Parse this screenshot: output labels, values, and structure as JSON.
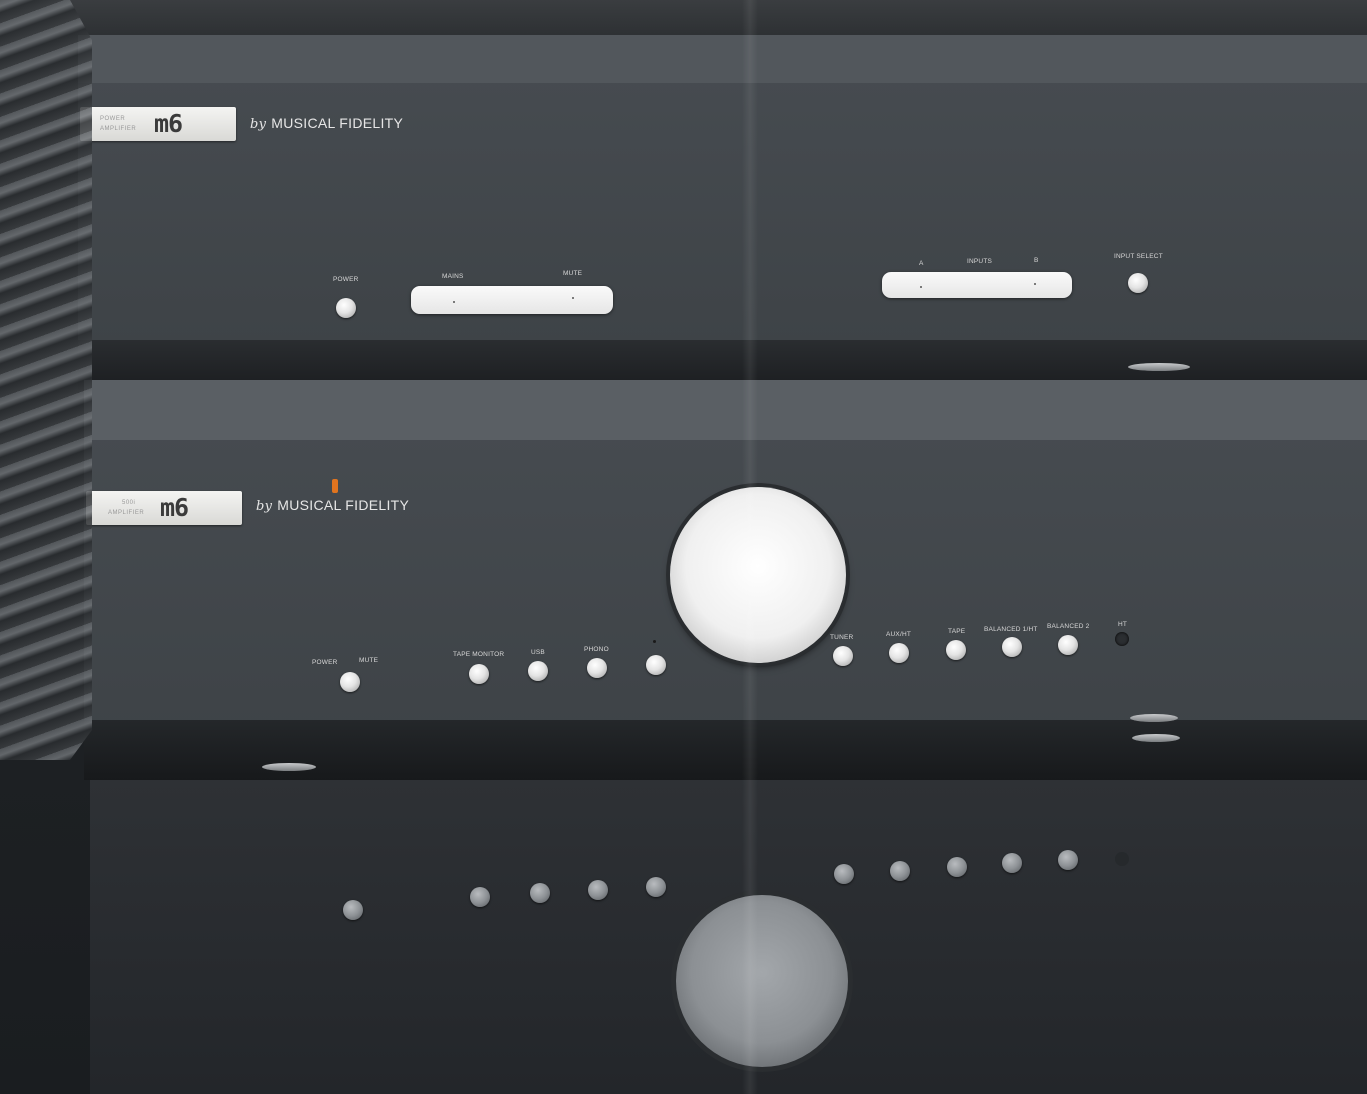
{
  "brand": {
    "by": "by",
    "name": "MUSICAL FIDELITY"
  },
  "power_amp": {
    "badge_line1": "POWER",
    "badge_line2": "AMPLIFIER",
    "model": "m6",
    "labels": {
      "power": "POWER",
      "mains": "MAINS",
      "mute": "MUTE",
      "inputs": "INPUTS",
      "input_a": "A",
      "input_b": "B",
      "input_select": "INPUT SELECT"
    }
  },
  "integrated_amp": {
    "badge_line1": "500i",
    "badge_line2": "AMPLIFIER",
    "model": "m6",
    "labels": {
      "power": "POWER",
      "mute": "MUTE"
    },
    "sources": [
      "TAPE MONITOR",
      "USB",
      "PHONO",
      "",
      "TUNER",
      "AUX/HT",
      "TAPE",
      "BALANCED 1/HT",
      "BALANCED 2",
      "HT"
    ]
  },
  "colors": {
    "indicator": "#e0741f",
    "chassis": "#464b50",
    "badge": "#efefec"
  }
}
